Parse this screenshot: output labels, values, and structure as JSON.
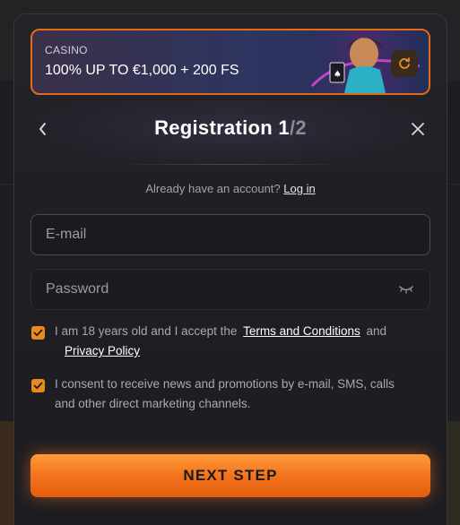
{
  "promo": {
    "label": "CASINO",
    "title": "100% UP TO €1,000 + 200 FS",
    "refresh_icon": "refresh-icon"
  },
  "header": {
    "title_main": "Registration 1",
    "title_total": "/2",
    "back_icon": "chevron-left-icon",
    "close_icon": "close-icon"
  },
  "login_prompt": {
    "text": "Already have an account?",
    "link": "Log in"
  },
  "form": {
    "email_placeholder": "E-mail",
    "password_placeholder": "Password",
    "eye_icon": "eye-closed-icon"
  },
  "terms": {
    "checked": true,
    "text_before": "I am 18 years old and I accept the",
    "terms_link": "Terms and Conditions",
    "and": "and",
    "privacy_link": "Privacy Policy"
  },
  "consent": {
    "checked": true,
    "text": "I consent to receive news and promotions by e-mail, SMS, calls and other direct marketing channels."
  },
  "next_button": {
    "label": "NEXT STEP"
  },
  "colors": {
    "accent": "#f2701a",
    "checkbox": "#e98a1e",
    "promo_border": "#e26a1a"
  }
}
